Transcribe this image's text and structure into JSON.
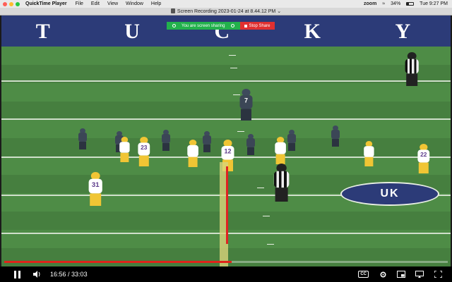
{
  "menubar": {
    "app_name": "QuickTime Player",
    "menus": [
      "File",
      "Edit",
      "View",
      "Window",
      "Help"
    ],
    "status_app": "zoom",
    "battery": "34%",
    "clock": "Tue 9:27 PM"
  },
  "window": {
    "title": "Screen Recording 2023-01-24 at 8.44.12 PM"
  },
  "video": {
    "stadium_banner": [
      "T",
      "U",
      "C",
      "K",
      "Y"
    ],
    "jerseys": [
      "7",
      "23",
      "12",
      "22",
      "31"
    ],
    "midfield_logo": "UK"
  },
  "zoom_banner": {
    "message": "You are screen sharing",
    "stop_label": "Stop Share",
    "stop_color": "#e03030",
    "banner_color": "#22b14c"
  },
  "playback": {
    "current_time": "16:56",
    "total_time": "33:03",
    "progress_fraction": 0.512,
    "progress_color": "#e0241a",
    "cc_label": "CC"
  }
}
